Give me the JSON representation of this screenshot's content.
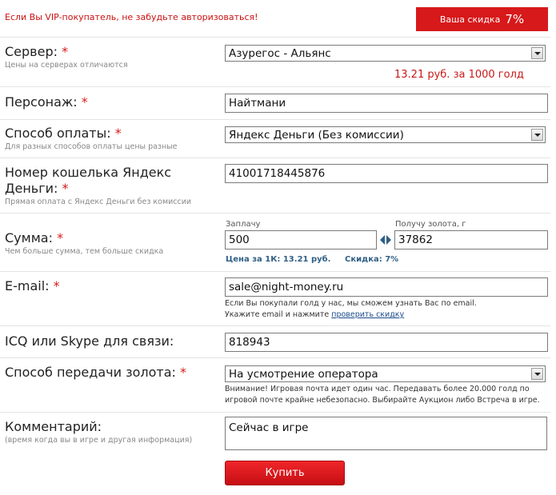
{
  "header": {
    "vip_notice": "Если Вы VIP-покупатель, не забудьте авторизоваться!",
    "discount_label": "Ваша скидка",
    "discount_value": "7%"
  },
  "form": {
    "server": {
      "label": "Сервер:",
      "hint": "Цены на серверах отличаются",
      "value": "Азурегос - Альянс",
      "price": "13.21 руб. за 1000 голд"
    },
    "character": {
      "label": "Персонаж:",
      "value": "Найтмани"
    },
    "payment": {
      "label": "Способ оплаты:",
      "hint": "Для разных способов оплаты цены разные",
      "value": "Яндекс Деньги (Без комиссии)"
    },
    "wallet": {
      "label_line1": "Номер кошелька Яндекс",
      "label_line2": "Деньги:",
      "hint": "Прямая оплата с Яндекс Деньги без комиссии",
      "value": "41001718445876"
    },
    "amount": {
      "label": "Сумма:",
      "hint": "Чем больше сумма, тем больше скидка",
      "pay_caption": "Заплачу",
      "pay_value": "500",
      "gold_caption": "Получу золота, г",
      "gold_value": "37862",
      "rate_text": "Цена за 1К: 13.21 руб.",
      "discount_text": "Скидка: 7%"
    },
    "email": {
      "label": "E-mail:",
      "value": "sale@night-money.ru",
      "note_line1": "Если Вы покупали голд у нас, мы сможем узнать Вас по email.",
      "note_line2_prefix": "Укажите email и нажмите ",
      "note_link": "проверить скидку"
    },
    "contact": {
      "label": "ICQ или Skype для связи:",
      "value": "818943"
    },
    "delivery": {
      "label": "Способ передачи золота:",
      "value": "На усмотрение оператора",
      "note_line1": "Внимание! Игровая почта идет один час. Передавать более 20.000 голд по",
      "note_line2": "игровой почте крайне небезопасно. Выбирайте Аукцион либо Встреча в игре."
    },
    "comment": {
      "label": "Комментарий:",
      "hint": "(время когда вы в игре и другая информация)",
      "value": "Сейчас в игре"
    },
    "required_mark": "*",
    "buy_label": "Купить"
  },
  "colors": {
    "accent_red": "#d7191b",
    "price_red": "#c81818",
    "link_blue": "#1c4b8e",
    "rate_blue": "#2f5f86"
  }
}
